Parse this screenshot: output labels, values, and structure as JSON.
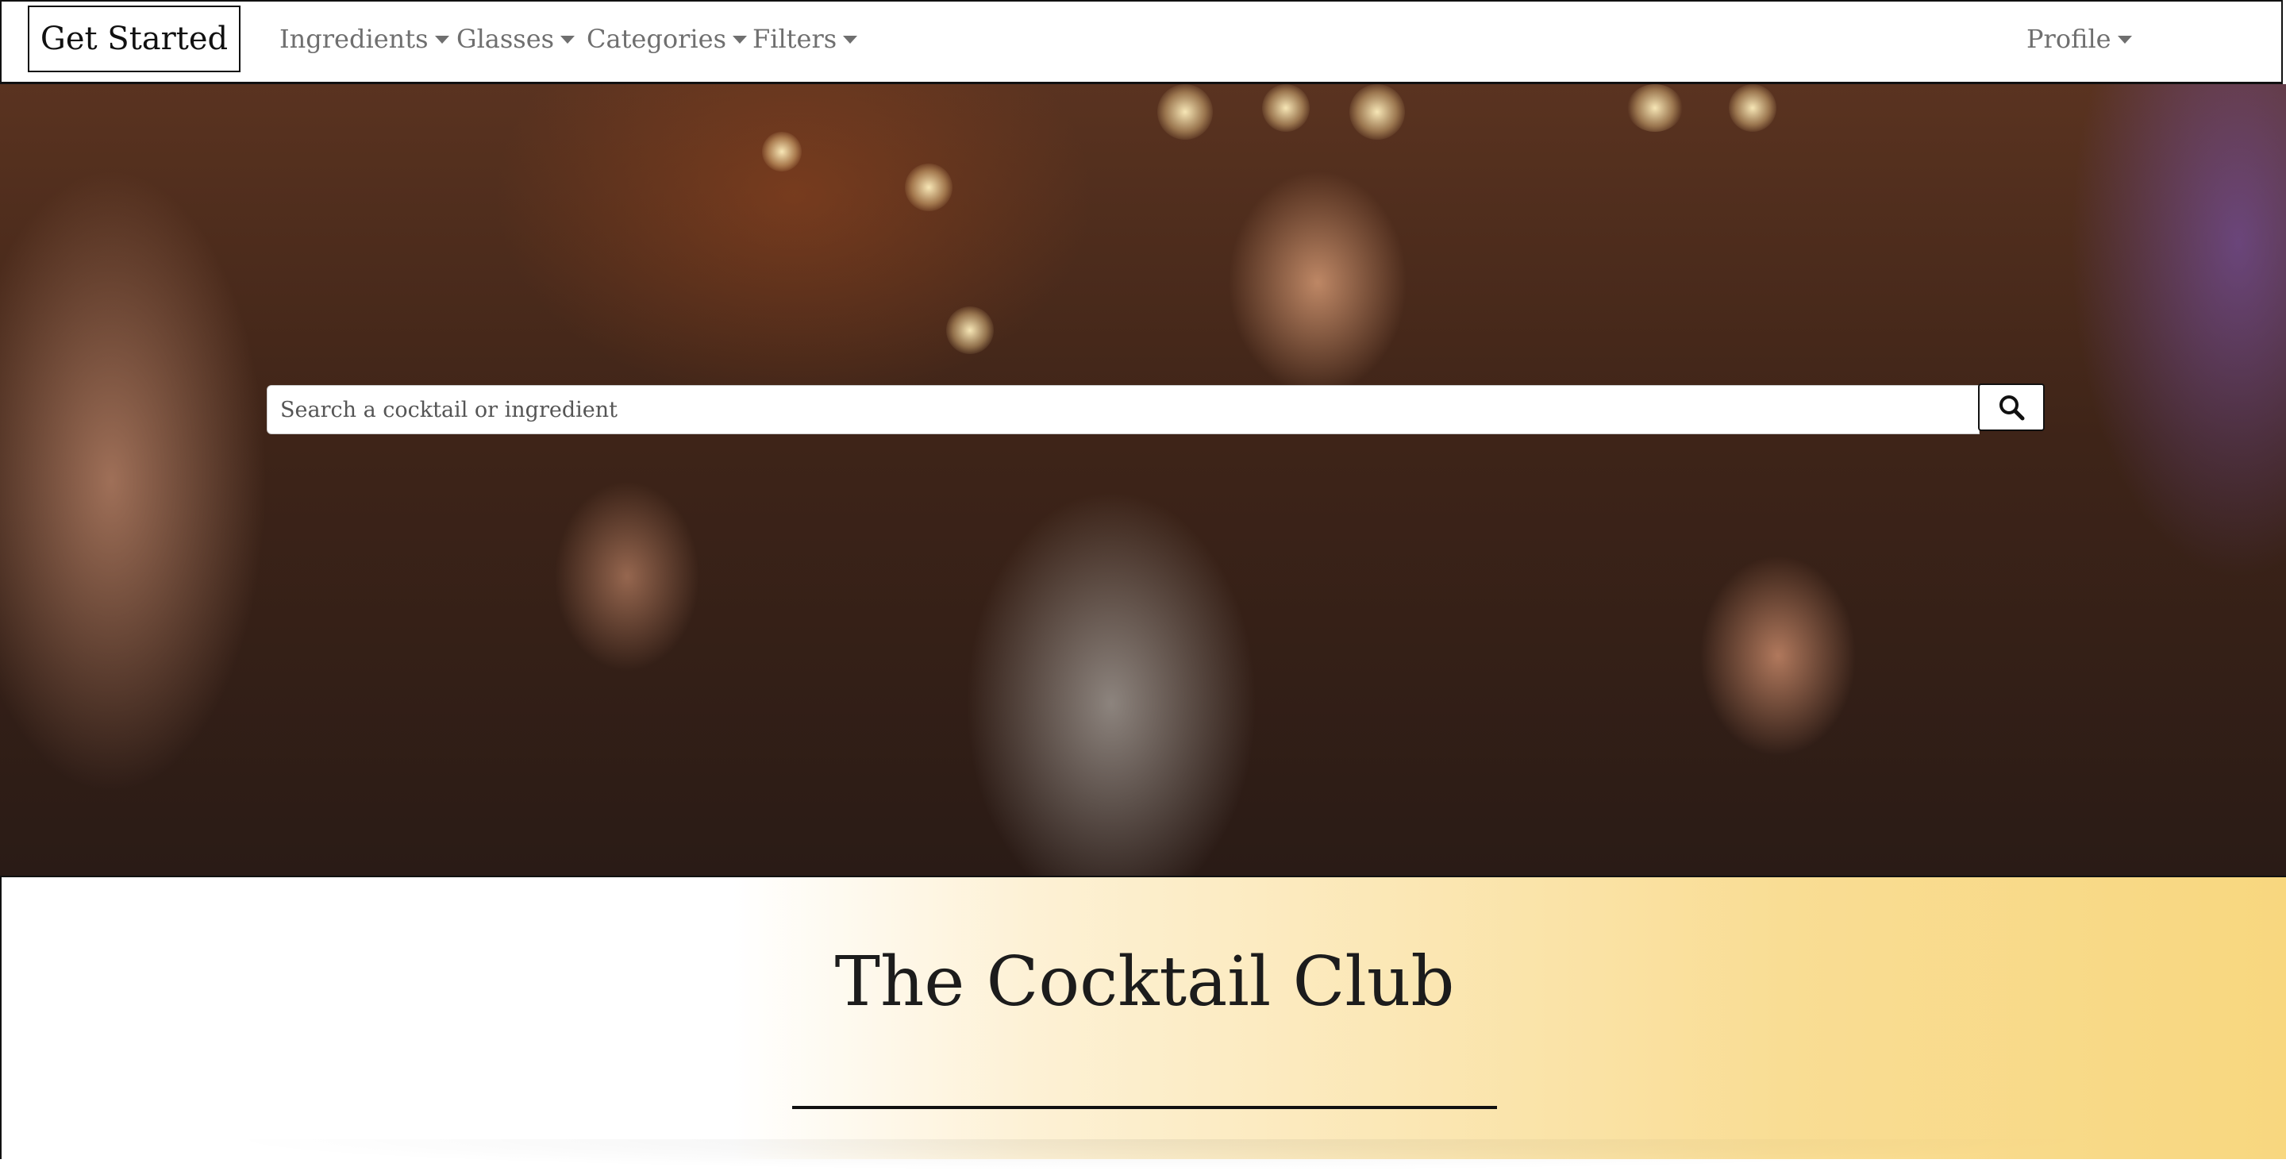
{
  "navbar": {
    "brand": "Get Started",
    "menus": [
      {
        "label": "Ingredients"
      },
      {
        "label": "Glasses"
      },
      {
        "label": "Categories"
      },
      {
        "label": "Filters"
      }
    ],
    "profile": "Profile"
  },
  "hero": {
    "search": {
      "placeholder": "Search a cocktail or ingredient",
      "button_icon": "search-icon"
    }
  },
  "main": {
    "title": "The Cocktail Club"
  },
  "colors": {
    "accent_gold": "#f8d77f",
    "nav_text": "#6f6f6f",
    "border": "#111111"
  }
}
